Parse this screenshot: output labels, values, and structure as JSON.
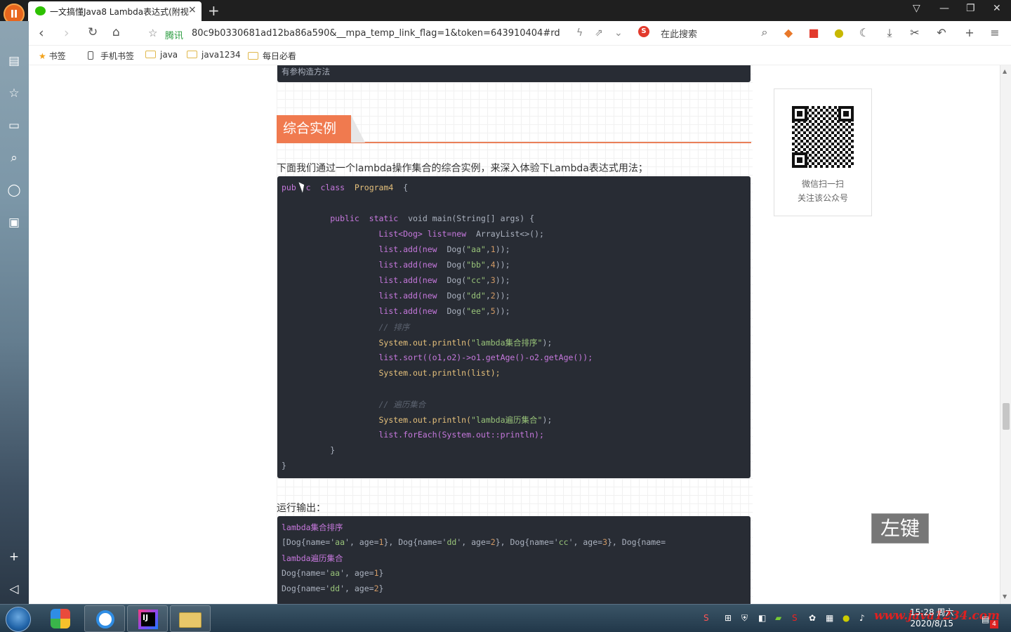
{
  "tab": {
    "title": "一文搞懂Java8 Lambda表达式(附视",
    "close": "×"
  },
  "newtab": "+",
  "address": {
    "source": "腾讯",
    "url": "80c9b0330681ad12ba86a590&__mpa_temp_link_flag=1&token=643910404#rd"
  },
  "search": {
    "label": "在此搜索",
    "engine_icon": "S"
  },
  "bookmarks": [
    {
      "label": "书签"
    },
    {
      "label": "手机书签"
    },
    {
      "label": "java"
    },
    {
      "label": "java1234"
    },
    {
      "label": "每日必看"
    }
  ],
  "article": {
    "top_code_tail": "有参构造方法",
    "heading": "综合实例",
    "intro": "下面我们通过一个lambda操作集合的综合实例，来深入体验下Lambda表达式用法；",
    "output_label": "运行输出：",
    "code": {
      "l1a": "pub",
      "l1b": "c",
      "l1c": "class",
      "l1d": "Program4",
      "l1e": "{",
      "l2a": "public",
      "l2b": "static",
      "l2c": "void main(String[] args) {",
      "l3a": "List<Dog>",
      "l3b": "list=",
      "l3c": "new",
      "l3d": "ArrayList<>();",
      "add": "list.add(",
      "new": "new",
      "dog": "Dog(",
      "a1": "\"aa\"",
      "n1": "1",
      "a2": "\"bb\"",
      "n2": "4",
      "a3": "\"cc\"",
      "n3": "3",
      "a4": "\"dd\"",
      "n4": "2",
      "a5": "\"ee\"",
      "n5": "5",
      "tail": "));",
      "c1": "// 排序",
      "p1a": "System.out.println(",
      "p1b": "\"lambda集合排序\"",
      "p1c": ");",
      "sort": "list.sort((o1,o2)->o1.getAge()-o2.getAge());",
      "p2": "System.out.println(list);",
      "c2": "// 遍历集合",
      "p3a": "System.out.println(",
      "p3b": "\"lambda遍历集合\"",
      "p3c": ");",
      "fe": "list.forEach(System.out::println);",
      "close1": "}",
      "close2": "}"
    },
    "output": {
      "o1": "lambda集合排序",
      "o2a": "[Dog{name='",
      "o2b": "aa",
      "o2c": "', age=",
      "o2d": "1",
      "o2e": "}, Dog{name='",
      "o2f": "dd",
      "o2g": "', age=",
      "o2h": "2",
      "o2i": "}, Dog{name='",
      "o2j": "cc",
      "o2k": "', age=",
      "o2l": "3",
      "o2m": "}, Dog{name=",
      "o3": "lambda遍历集合",
      "o4a": "Dog{name='",
      "o4b": "aa",
      "o4c": "', age=",
      "o4d": "1",
      "o4e": "}",
      "o5a": "Dog{name='",
      "o5b": "dd",
      "o5c": "', age=",
      "o5d": "2",
      "o5e": "}"
    }
  },
  "qr": {
    "line1": "微信扫一扫",
    "line2": "关注该公众号"
  },
  "overlay": "左键",
  "taskbar": {
    "time": "15:28 周六",
    "date": "2020/8/15",
    "watermark": "www.java1234.com",
    "badge": "4"
  }
}
